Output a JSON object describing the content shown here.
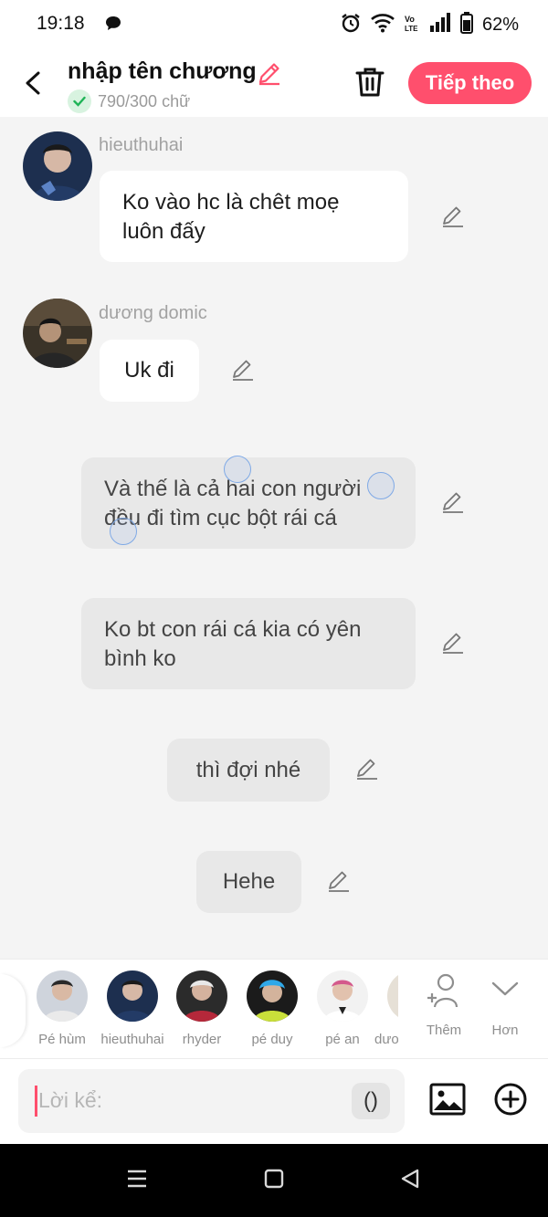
{
  "status_bar": {
    "time": "19:18",
    "battery": "62%"
  },
  "header": {
    "title": "nhập tên chương",
    "word_count": "790/300 chữ",
    "next_label": "Tiếp theo",
    "accent_color": "#ff4f6d"
  },
  "messages": [
    {
      "sender": "hieuthuhai",
      "text": "Ko vào hc là chêt moẹ luôn đấy",
      "type": "character"
    },
    {
      "sender": "dương domic",
      "text": "Uk đi",
      "type": "character"
    },
    {
      "text": "Và thế là cả hai con người đều đi tìm cục bột rái cá",
      "type": "narration"
    },
    {
      "text": "Ko bt con rái cá kia có yên bình ko",
      "type": "narration"
    },
    {
      "text": "thì đợi nhé",
      "type": "narration"
    },
    {
      "text": "Hehe",
      "type": "narration"
    }
  ],
  "characters": [
    {
      "name": "Pé hùm"
    },
    {
      "name": "hieuthuhai"
    },
    {
      "name": "rhyder"
    },
    {
      "name": "pé duy"
    },
    {
      "name": "pé an"
    },
    {
      "name": "dươ"
    }
  ],
  "strip_actions": {
    "add_label": "Thêm",
    "more_label": "Hơn"
  },
  "composer": {
    "placeholder": "Lời kể:",
    "paren_label": "()"
  },
  "icons": [
    "alarm-icon",
    "wifi-icon",
    "volte-icon",
    "signal-icon",
    "battery-icon",
    "back-icon",
    "pencil-icon",
    "check-icon",
    "trash-icon",
    "add-person-icon",
    "chevron-down-icon",
    "image-icon",
    "plus-circle-icon",
    "menu-icon",
    "home-square-icon",
    "back-triangle-icon"
  ]
}
